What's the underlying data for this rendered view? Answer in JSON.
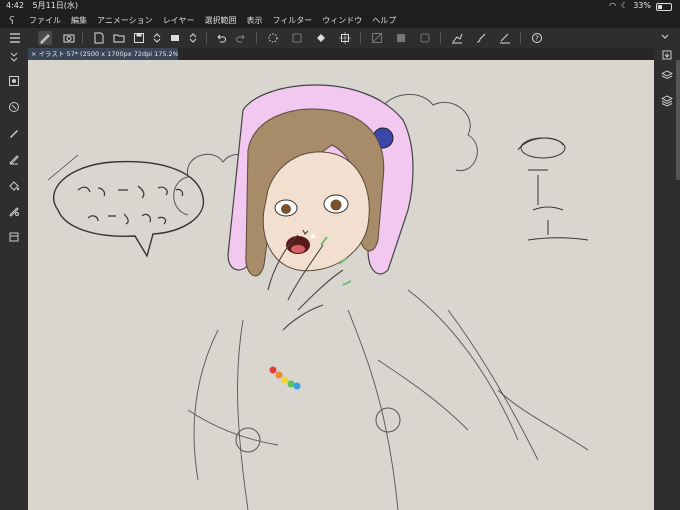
{
  "status": {
    "time": "4:42",
    "date": "5月11日(水)",
    "battery": "33%"
  },
  "menu": {
    "items": [
      "ファイル",
      "編集",
      "アニメーション",
      "レイヤー",
      "選択範囲",
      "表示",
      "フィルター",
      "ウィンドウ",
      "ヘルプ"
    ]
  },
  "toolbar": {
    "icons": [
      "menu-icon",
      "pen-icon",
      "stamp-icon",
      "new-file-icon",
      "open-folder-icon",
      "save-icon",
      "undo-icon",
      "redo-icon",
      "spinner-icon",
      "clear-icon",
      "fill-icon",
      "transform-icon",
      "ruler-icon",
      "mask-icon",
      "lasso-icon",
      "chart-icon",
      "brush-icon",
      "graph-icon",
      "help-icon"
    ]
  },
  "canvas_tab": {
    "title": "× イラスト 57* (2500 x 1700px 72dpi 175.2%)"
  },
  "left_tools": [
    "brush-settings-icon",
    "reset-icon",
    "pen-tool-icon",
    "pencil-tool-icon",
    "fill-tool-icon",
    "pattern-icon",
    "layer-panel-icon"
  ],
  "right_tools": [
    "export-icon",
    "layers-icon",
    "materials-icon"
  ],
  "colors": {
    "canvas": "#d9d5cf",
    "hood": "#f2c7f0",
    "hair": "#a88c6a",
    "tab": "#3a4658",
    "chrome": "#2e2e2e"
  }
}
